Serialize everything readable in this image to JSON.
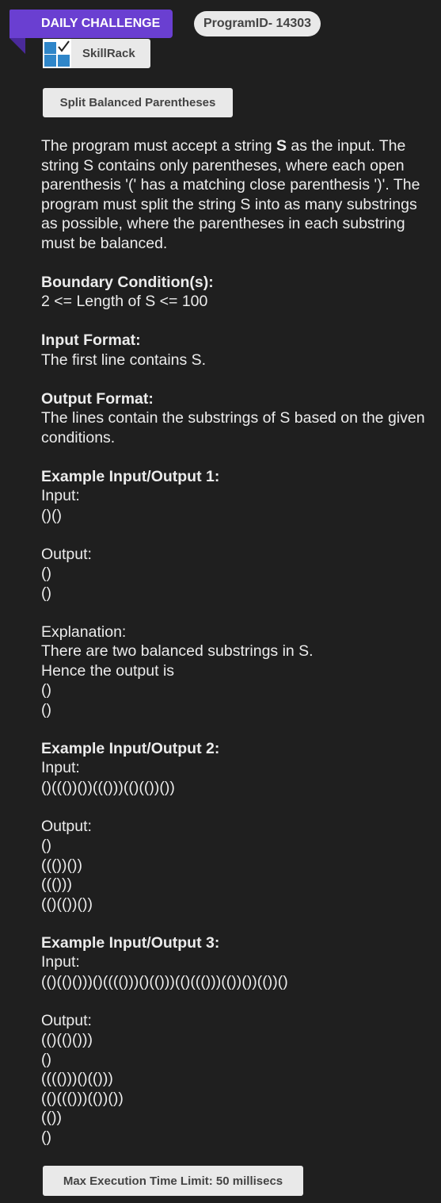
{
  "header": {
    "ribbon_label": "DAILY CHALLENGE",
    "program_id": "ProgramID- 14303",
    "brand_name": "SkillRack",
    "brand_logo_icon": "skillrack-logo-icon"
  },
  "problem": {
    "title": "Split Balanced Parentheses",
    "description": {
      "part1": "The program must accept a string ",
      "var": "S",
      "part2": " as the input. The string S contains only parentheses, where each open parenthesis '(' has a matching close parenthesis ')'. The program must split the string S into as many substrings as possible, where the parentheses in each substring must be balanced."
    },
    "boundary_heading": "Boundary Condition(s):",
    "boundary_text": "2 <= Length of S <= 100",
    "input_heading": "Input Format:",
    "input_text": "The first line contains S.",
    "output_heading": "Output Format:",
    "output_text": "The lines contain the substrings of S based on the given conditions.",
    "examples": [
      {
        "heading": "Example Input/Output 1:",
        "input_label": "Input:",
        "input": "()()",
        "output_label": "Output:",
        "outputs": [
          "()",
          "()"
        ],
        "explanation_label": "Explanation:",
        "explanation_line1": "There are two balanced substrings in S.",
        "explanation_line2": "Hence the output is",
        "explanation_outputs": [
          "()",
          "()"
        ]
      },
      {
        "heading": "Example Input/Output 2:",
        "input_label": "Input:",
        "input": "()((())())((()))(()(())())",
        "output_label": "Output:",
        "outputs": [
          "()",
          "((())())",
          "((()))",
          "(()(())())"
        ]
      },
      {
        "heading": "Example Input/Output 3:",
        "input_label": "Input:",
        "input": "(()(()()))()(((()))()(()))(()((()))(())())(())()",
        "output_label": "Output:",
        "outputs": [
          "(()(()()))",
          "()",
          "(((()))()(()))",
          "(()((()))(())())",
          "(())",
          "()"
        ]
      }
    ],
    "time_limit": "Max Execution Time Limit: 50 millisecs"
  }
}
